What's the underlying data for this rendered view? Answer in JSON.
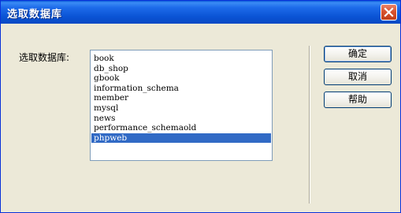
{
  "window": {
    "title": "选取数据库"
  },
  "label": "选取数据库:",
  "database_list": [
    "book",
    "db_shop",
    "gbook",
    "information_schema",
    "member",
    "mysql",
    "news",
    "performance_schemaold",
    "phpweb"
  ],
  "selected_index": 8,
  "buttons": {
    "ok": "确定",
    "cancel": "取消",
    "help": "帮助"
  },
  "colors": {
    "title_bar": "#0a53d4",
    "selection": "#316ac5",
    "dialog_bg": "#ece9d8",
    "close_button": "#d9532e"
  },
  "icons": {
    "close": "close-icon"
  }
}
